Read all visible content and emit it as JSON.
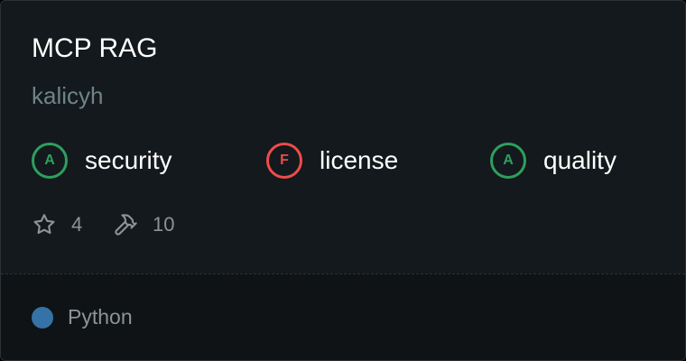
{
  "card": {
    "title": "MCP RAG",
    "author": "kalicyh"
  },
  "grades": [
    {
      "grade": "A",
      "label": "security",
      "status_color": "#2f9e5e"
    },
    {
      "grade": "F",
      "label": "license",
      "status_color": "#ee4b4b"
    },
    {
      "grade": "A",
      "label": "quality",
      "status_color": "#2f9e5e"
    }
  ],
  "stats": {
    "stars": {
      "icon": "star-icon",
      "value": "4"
    },
    "tools": {
      "icon": "hammer-icon",
      "value": "10"
    }
  },
  "footer": {
    "language": "Python",
    "language_color": "#3572a5"
  }
}
